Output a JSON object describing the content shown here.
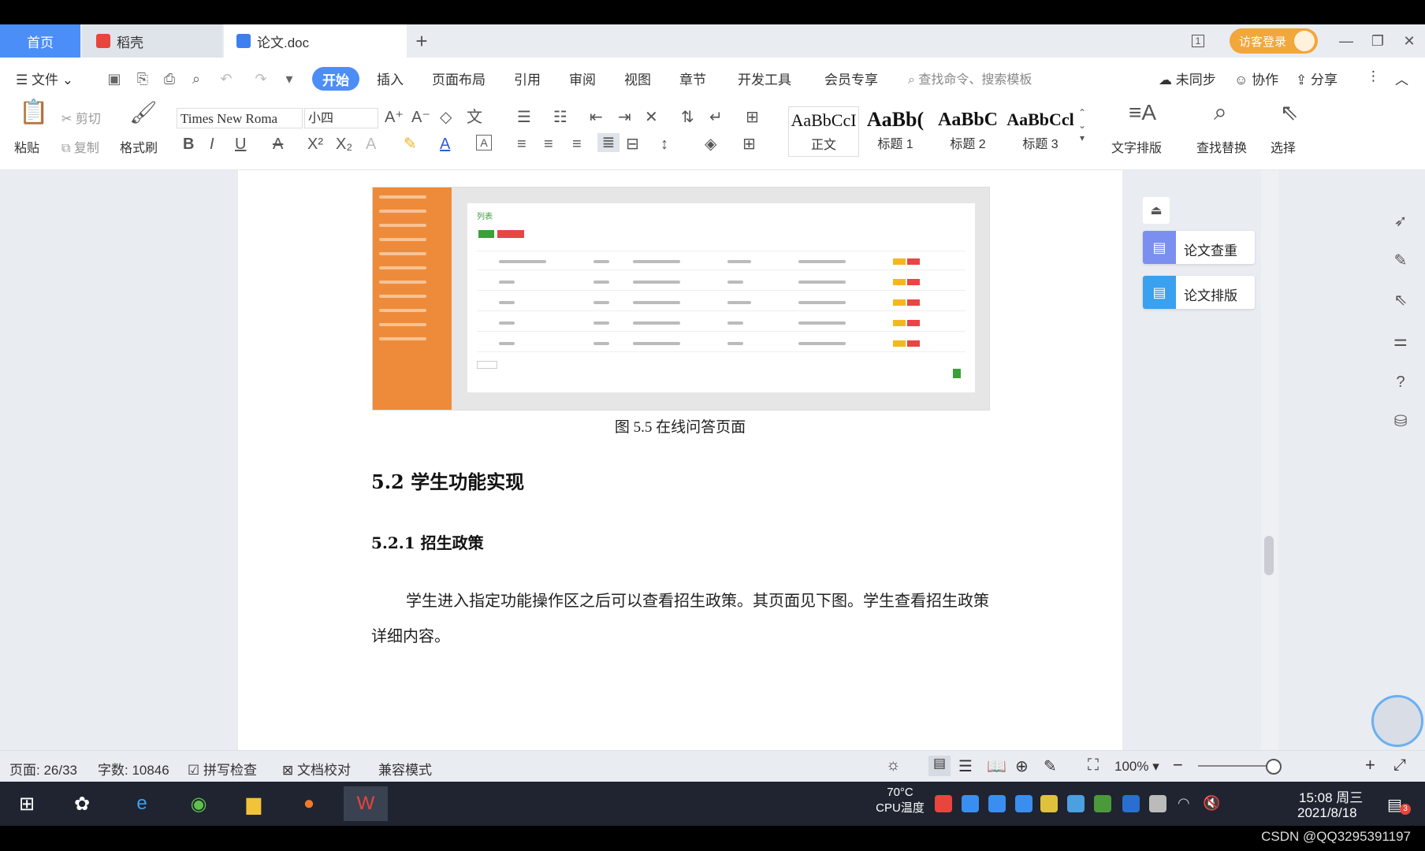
{
  "tabs": {
    "home": "首页",
    "daoke": "稻壳",
    "doc": "论文.doc",
    "plus": "+"
  },
  "window": {
    "guest_login": "访客登录",
    "page_count_icon": "1"
  },
  "menu": {
    "file": "文件",
    "start": "开始",
    "insert": "插入",
    "layout": "页面布局",
    "reference": "引用",
    "review": "审阅",
    "view": "视图",
    "chapter": "章节",
    "devtools": "开发工具",
    "member": "会员专享",
    "search_placeholder": "查找命令、搜索模板",
    "unsynced": "未同步",
    "collab": "协作",
    "share": "分享"
  },
  "ribbon": {
    "paste": "粘贴",
    "cut": "剪切",
    "copy": "复制",
    "format_painter": "格式刷",
    "font_name": "Times New Roma",
    "font_size": "小四",
    "styles": [
      {
        "sample": "AaBbCcI",
        "label": "正文"
      },
      {
        "sample": "AaBb(",
        "label": "标题 1"
      },
      {
        "sample": "AaBbC",
        "label": "标题 2"
      },
      {
        "sample": "AaBbCcl",
        "label": "标题 3"
      }
    ],
    "text_layout": "文字排版",
    "find_replace": "查找替换",
    "select": "选择"
  },
  "document": {
    "figure_caption": "图 5.5  在线问答页面",
    "figure_panel_title": "列表",
    "heading_2": "5.2  学生功能实现",
    "heading_3": "5.2.1  招生政策",
    "paragraph": "学生进入指定功能操作区之后可以查看招生政策。其页面见下图。学生查看招生政策详细内容。"
  },
  "right_panel": {
    "check": "论文查重",
    "format": "论文排版"
  },
  "status": {
    "page": "页面: 26/33",
    "words": "字数: 10846",
    "spell": "拼写检查",
    "proof": "文档校对",
    "compat": "兼容模式",
    "zoom": "100%"
  },
  "taskbar": {
    "cpu_temp": "70°C",
    "cpu_label": "CPU温度",
    "time": "15:08 周三",
    "date": "2021/8/18",
    "notify_count": "3"
  },
  "watermark": "CSDN @QQ3295391197",
  "colors": {
    "accent": "#4c8ef7",
    "guest": "#f2a73b",
    "figure_sidebar": "#ee8b3a"
  }
}
